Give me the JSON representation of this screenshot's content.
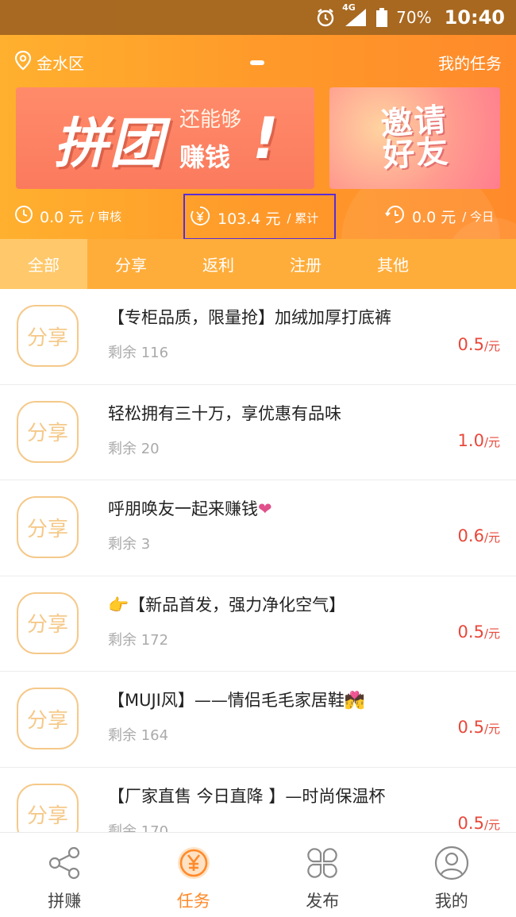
{
  "status_bar": {
    "network": "4G",
    "battery": "70%",
    "time": "10:40"
  },
  "header": {
    "location": "金水区",
    "my_tasks": "我的任务"
  },
  "banner_left": {
    "big_text": "拼团",
    "line1": "还能够",
    "line2": "赚钱",
    "mark": "!"
  },
  "banner_right": {
    "text": "邀请好友"
  },
  "stats": {
    "pending": {
      "value": "0.0 元",
      "label": "/ 审核"
    },
    "total": {
      "value": "103.4 元",
      "label": "/ 累计"
    },
    "today": {
      "value": "0.0 元",
      "label": "/ 今日"
    }
  },
  "tabs": [
    {
      "label": "全部"
    },
    {
      "label": "分享"
    },
    {
      "label": "返利"
    },
    {
      "label": "注册"
    },
    {
      "label": "其他"
    }
  ],
  "tasks": [
    {
      "badge": "分享",
      "title": "【专柜品质，限量抢】加绒加厚打底裤",
      "remain": "剩余 116",
      "price": "0.5",
      "unit": "/元"
    },
    {
      "badge": "分享",
      "title": "轻松拥有三十万，享优惠有品味",
      "remain": "剩余 20",
      "price": "1.0",
      "unit": "/元"
    },
    {
      "badge": "分享",
      "title": "呼朋唤友一起来赚钱",
      "emoji": "❤",
      "remain": "剩余 3",
      "price": "0.6",
      "unit": "/元"
    },
    {
      "badge": "分享",
      "title": "【新品首发，强力净化空气】",
      "emoji_prefix": "👉",
      "remain": "剩余 172",
      "price": "0.5",
      "unit": "/元"
    },
    {
      "badge": "分享",
      "title": "【MUJI风】——情侣毛毛家居鞋",
      "emoji": "💏",
      "remain": "剩余 164",
      "price": "0.5",
      "unit": "/元"
    },
    {
      "badge": "分享",
      "title": "【厂家直售 今日直降 】—时尚保温杯",
      "remain": "剩余 170",
      "price": "0.5",
      "unit": "/元"
    }
  ],
  "bottom_nav": [
    {
      "label": "拼赚",
      "icon": "share-icon"
    },
    {
      "label": "任务",
      "icon": "yuan-coin-icon",
      "active": true
    },
    {
      "label": "发布",
      "icon": "grid-flower-icon"
    },
    {
      "label": "我的",
      "icon": "person-icon"
    }
  ],
  "colors": {
    "accent": "#ff8a2a",
    "price": "#e8483a",
    "badge": "#f5c98a"
  }
}
